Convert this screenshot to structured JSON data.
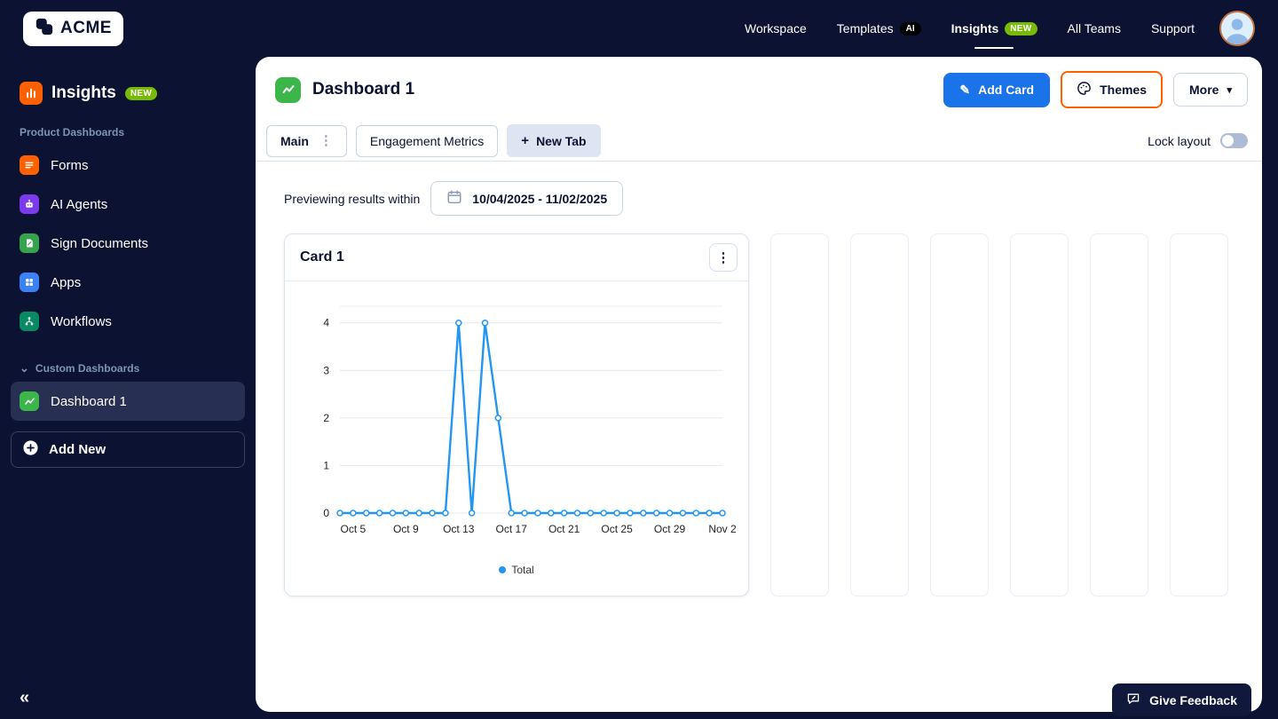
{
  "topbar": {
    "logo_text": "ACME",
    "nav": [
      {
        "label": "Workspace"
      },
      {
        "label": "Templates",
        "badge": "AI"
      },
      {
        "label": "Insights",
        "badge": "NEW"
      },
      {
        "label": "All Teams"
      },
      {
        "label": "Support"
      }
    ]
  },
  "sidebar": {
    "title": "Insights",
    "title_badge": "NEW",
    "sections": {
      "product": "Product Dashboards",
      "custom": "Custom Dashboards"
    },
    "items": [
      {
        "label": "Forms"
      },
      {
        "label": "AI Agents"
      },
      {
        "label": "Sign Documents"
      },
      {
        "label": "Apps"
      },
      {
        "label": "Workflows"
      }
    ],
    "custom_items": [
      {
        "label": "Dashboard 1"
      }
    ],
    "add_new_label": "Add New"
  },
  "main": {
    "page_title": "Dashboard 1",
    "toolbar": {
      "add_card_label": "Add Card",
      "themes_label": "Themes",
      "more_label": "More"
    },
    "tabs": [
      {
        "label": "Main"
      },
      {
        "label": "Engagement Metrics"
      },
      {
        "label": "New Tab"
      }
    ],
    "lock_layout_label": "Lock layout",
    "preview_label": "Previewing results within",
    "date_range": "10/04/2025 - 11/02/2025",
    "card": {
      "title": "Card 1"
    },
    "feedback_label": "Give Feedback"
  },
  "icons": {
    "pencil": "✎",
    "kebab": "⋮",
    "chevron_down": "▾",
    "section_chevron": "⌄",
    "plus": "+",
    "collapse": "«"
  },
  "colors": {
    "accent_blue": "#1a73e8",
    "accent_orange": "#ff6100",
    "badge_green": "#78bb07",
    "chart_line": "#2196f3",
    "navy": "#0c1231"
  },
  "chart_data": {
    "type": "line",
    "title": "Card 1",
    "x": [
      "Oct 4",
      "Oct 5",
      "Oct 6",
      "Oct 7",
      "Oct 8",
      "Oct 9",
      "Oct 10",
      "Oct 11",
      "Oct 12",
      "Oct 13",
      "Oct 14",
      "Oct 15",
      "Oct 16",
      "Oct 17",
      "Oct 18",
      "Oct 19",
      "Oct 20",
      "Oct 21",
      "Oct 22",
      "Oct 23",
      "Oct 24",
      "Oct 25",
      "Oct 26",
      "Oct 27",
      "Oct 28",
      "Oct 29",
      "Oct 30",
      "Oct 31",
      "Nov 1",
      "Nov 2"
    ],
    "series": [
      {
        "name": "Total",
        "values": [
          0,
          0,
          0,
          0,
          0,
          0,
          0,
          0,
          0,
          4,
          0,
          4,
          2,
          0,
          0,
          0,
          0,
          0,
          0,
          0,
          0,
          0,
          0,
          0,
          0,
          0,
          0,
          0,
          0,
          0
        ]
      }
    ],
    "x_tick_labels": [
      "Oct 5",
      "Oct 9",
      "Oct 13",
      "Oct 17",
      "Oct 21",
      "Oct 25",
      "Oct 29",
      "Nov 2"
    ],
    "tick_indices": [
      1,
      5,
      9,
      13,
      17,
      21,
      25,
      29
    ],
    "y_ticks": [
      0,
      1,
      2,
      3,
      4
    ],
    "ylim": [
      0,
      4.35
    ],
    "grid": true,
    "legend_position": "bottom",
    "line_color": "#2196f3",
    "xlabel": "",
    "ylabel": ""
  }
}
